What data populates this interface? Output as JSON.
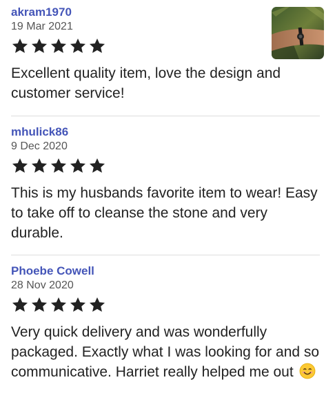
{
  "reviews": [
    {
      "username": "akram1970",
      "date": "19 Mar 2021",
      "rating": 5,
      "text": "Excellent quality item, love the design and customer service!",
      "has_photo": true
    },
    {
      "username": "mhulick86",
      "date": "9 Dec 2020",
      "rating": 5,
      "text": "This is my husbands favorite item to wear! Easy to take off to cleanse the stone and very durable."
    },
    {
      "username": "Phoebe Cowell",
      "date": "28 Nov 2020",
      "rating": 5,
      "text": "Very quick delivery and was wonderfully packaged. Exactly what I was looking for and so communicative. Harriet really helped me out",
      "emoji": "smiling-face-emoji"
    }
  ],
  "colors": {
    "username": "#4455b8",
    "star": "#222222",
    "date": "#555555",
    "divider": "#dddddd"
  },
  "icons": {
    "star": "star-icon",
    "photo": "review-photo"
  }
}
